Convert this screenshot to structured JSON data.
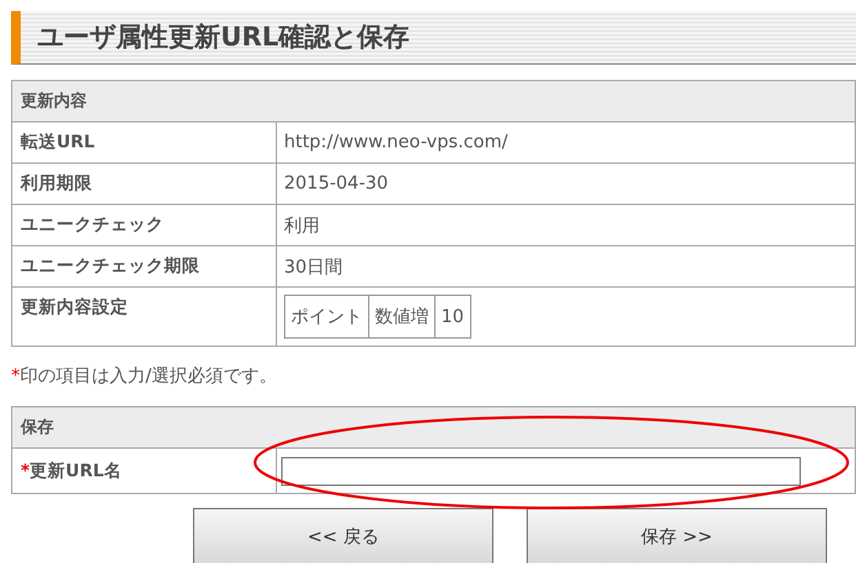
{
  "title": "ユーザ属性更新URL確認と保存",
  "details": {
    "heading": "更新内容",
    "rows": [
      {
        "kind": "text",
        "label": "転送URL",
        "value": "http://www.neo-vps.com/"
      },
      {
        "kind": "text",
        "label": "利用期限",
        "value": "2015-04-30"
      },
      {
        "kind": "text",
        "label": "ユニークチェック",
        "value": "利用"
      },
      {
        "kind": "text",
        "label": "ユニークチェック期限",
        "value": "30日間"
      },
      {
        "kind": "settings",
        "label": "更新内容設定",
        "cells": [
          "ポイント",
          "数値増",
          "10"
        ]
      }
    ]
  },
  "note": {
    "mark": "*",
    "text": "印の項目は入力/選択必須です。"
  },
  "save": {
    "heading": "保存",
    "field": {
      "mark": "*",
      "label": "更新URL名"
    }
  },
  "buttons": [
    "<< 戻る",
    "保存 >>"
  ]
}
